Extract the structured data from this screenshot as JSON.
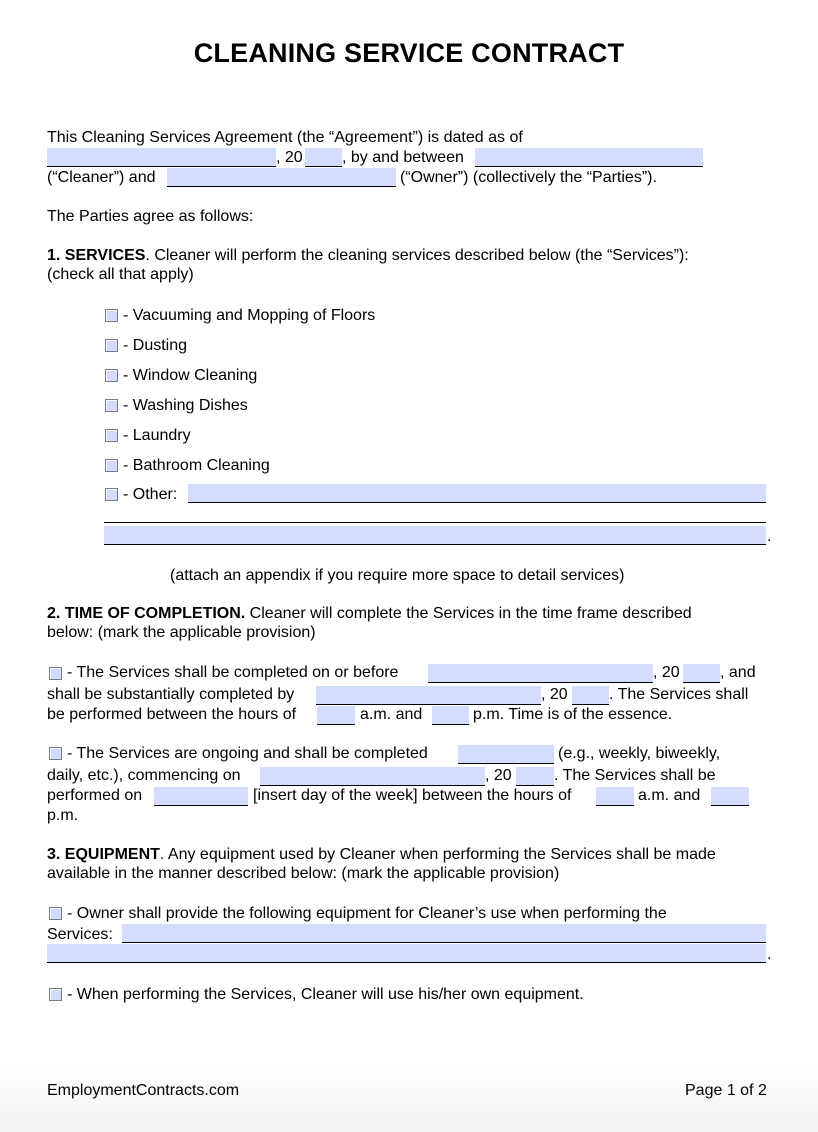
{
  "title": "CLEANING SERVICE CONTRACT",
  "intro": {
    "line1": "This Cleaning Services Agreement (the “Agreement”) is dated as of",
    "year_prefix": ", 20",
    "by_and_between": ", by and between",
    "cleaner_and": "(“Cleaner”) and",
    "owner_parties": "(“Owner”) (collectively the “Parties”).",
    "fields": {
      "date": "",
      "year": "",
      "cleaner_name": "",
      "owner_name": ""
    }
  },
  "parties_agree": "The Parties agree as follows:",
  "section1": {
    "heading": "1. SERVICES",
    "text": ". Cleaner will perform the cleaning services described below (the “Services”):",
    "text2": "(check all that apply)",
    "options": [
      {
        "label": "- Vacuuming and Mopping of Floors",
        "checked": false
      },
      {
        "label": "- Dusting",
        "checked": false
      },
      {
        "label": "- Window Cleaning",
        "checked": false
      },
      {
        "label": "- Washing Dishes",
        "checked": false
      },
      {
        "label": "- Laundry",
        "checked": false
      },
      {
        "label": "- Bathroom Cleaning",
        "checked": false
      },
      {
        "label": "- Other:",
        "checked": false
      }
    ],
    "other_value": "",
    "other_value_2": "",
    "period": ".",
    "appendix_note": "(attach an appendix if you require more space to detail services)"
  },
  "section2": {
    "heading": "2. TIME OF COMPLETION.",
    "text": " Cleaner will complete the Services in the time frame described",
    "text2": "below: (mark the applicable provision)",
    "option_a": {
      "checked": false,
      "l1": "- The Services shall be completed on or before",
      "l1_year": ", 20",
      "l1_end": ", and",
      "l2": "shall be substantially completed by",
      "l2_year": ", 20",
      "l2_end": ". The Services shall",
      "l3": "be performed between the hours of",
      "l3_mid": "a.m. and",
      "l3_end": "p.m. Time is of the essence.",
      "fields": {
        "complete_date": "",
        "complete_year": "",
        "substantial_date": "",
        "substantial_year": "",
        "start_hour": "",
        "end_hour": ""
      }
    },
    "option_b": {
      "checked": false,
      "l1": "- The Services are ongoing and shall be completed",
      "l1_end": "(e.g., weekly, biweekly,",
      "l2": "daily, etc.), commencing on",
      "l2_year": ", 20",
      "l2_end": ". The Services shall be",
      "l3": "performed on",
      "l3_mid": "[insert day of the week] between the hours of",
      "l3_am": "a.m. and",
      "l4": "p.m.",
      "fields": {
        "frequency": "",
        "commence_date": "",
        "commence_year": "",
        "day_of_week": "",
        "start_hour": "",
        "end_hour": ""
      }
    }
  },
  "section3": {
    "heading": "3. EQUIPMENT",
    "text": ". Any equipment used by Cleaner when performing the Services shall be made",
    "text2": "available in the manner described below: (mark the applicable provision)",
    "option_a": {
      "checked": false,
      "l1": "- Owner shall provide the following equipment for Cleaner’s use when performing the",
      "l2": "Services:",
      "value": "",
      "value_2": "",
      "period": "."
    },
    "option_b": {
      "checked": false,
      "l1": "- When performing the Services, Cleaner will use his/her own equipment."
    }
  },
  "footer": {
    "site": "EmploymentContracts.com",
    "page": "Page 1 of 2"
  },
  "colors": {
    "field_fill": "#d4dcfe",
    "checkbox_border": "#7a7a85"
  }
}
